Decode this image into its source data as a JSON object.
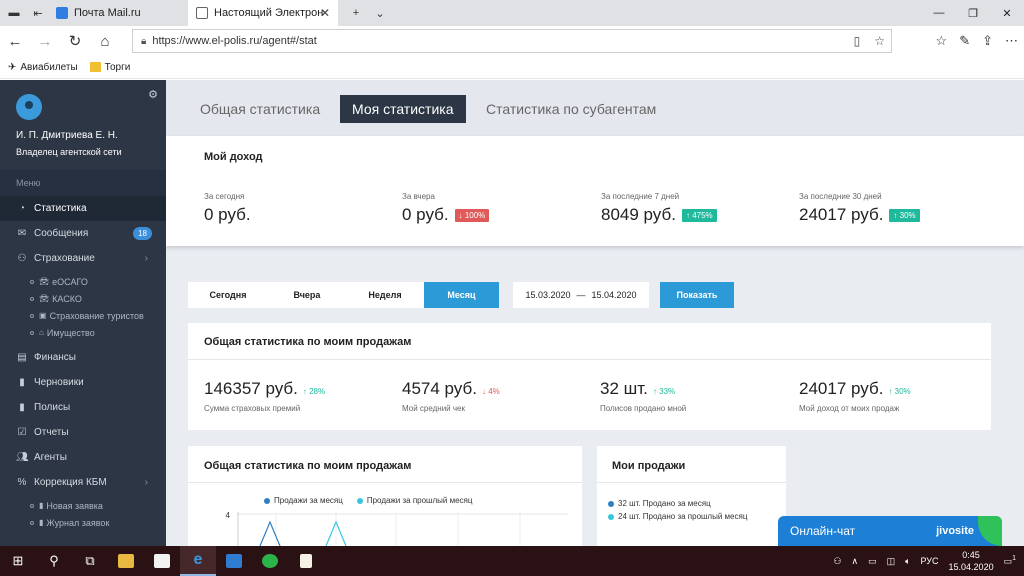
{
  "browser": {
    "tabs": [
      {
        "label": "Почта Mail.ru",
        "active": false
      },
      {
        "label": "Настоящий Электронн",
        "active": true
      }
    ],
    "url": "https://www.el-polis.ru/agent#/stat",
    "bookmarks": [
      "Авиабилеты",
      "Торги"
    ]
  },
  "sidebar": {
    "name": "И. П. Дмитриева Е. Н.",
    "role": "Владелец агентской сети",
    "menu_title": "Меню",
    "items": [
      {
        "label": "Статистика",
        "icon": "pie-chart-icon"
      },
      {
        "label": "Сообщения",
        "icon": "envelope-icon",
        "badge": "18"
      },
      {
        "label": "Страхование",
        "icon": "sitemap-icon"
      },
      {
        "label": "Финансы",
        "icon": "money-icon"
      },
      {
        "label": "Черновики",
        "icon": "file-icon"
      },
      {
        "label": "Полисы",
        "icon": "file-text-icon"
      },
      {
        "label": "Отчеты",
        "icon": "check-square-icon"
      },
      {
        "label": "Агенты",
        "icon": "users-icon"
      },
      {
        "label": "Коррекция КБМ",
        "icon": "percent-icon"
      }
    ],
    "insurance_sub": [
      "еОСАГО",
      "КАСКО",
      "Страхование туристов",
      "Имущество"
    ],
    "kbm_sub": [
      "Новая заявка",
      "Журнал заявок"
    ]
  },
  "main": {
    "tabs": [
      "Общая статистика",
      "Моя статистика",
      "Статистика по субагентам"
    ],
    "income": {
      "title": "Мой доход",
      "kpis": [
        {
          "label": "За сегодня",
          "value": "0 руб.",
          "change": ""
        },
        {
          "label": "За вчера",
          "value": "0 руб.",
          "change": "↓ 100%",
          "dir": "down"
        },
        {
          "label": "За последние 7 дней",
          "value": "8049 руб.",
          "change": "↑ 475%",
          "dir": "up"
        },
        {
          "label": "За последние 30 дней",
          "value": "24017 руб.",
          "change": "↑ 30%",
          "dir": "up"
        }
      ]
    },
    "filter": {
      "periods": [
        "Сегодня",
        "Вчера",
        "Неделя",
        "Месяц"
      ],
      "active_period": "Месяц",
      "date_from": "15.03.2020",
      "date_sep": "—",
      "date_to": "15.04.2020",
      "show_label": "Показать"
    },
    "sales": {
      "title": "Общая статистика по моим продажам",
      "kpis": [
        {
          "value": "146357 руб.",
          "change": "↑ 28%",
          "dir": "up",
          "label": "Сумма страховых премий"
        },
        {
          "value": "4574 руб.",
          "change": "↓ 4%",
          "dir": "down",
          "label": "Мой средний чек"
        },
        {
          "value": "32 шт.",
          "change": "↑ 33%",
          "dir": "up",
          "label": "Полисов продано мной"
        },
        {
          "value": "24017 руб.",
          "change": "↑ 30%",
          "dir": "up",
          "label": "Мой доход от моих продаж"
        }
      ]
    },
    "chart_card": {
      "title": "Общая статистика по моим продажам",
      "legend": [
        "Продажи за месяц",
        "Продажи за прошлый месяц"
      ],
      "y_tick": "4"
    },
    "my_sales": {
      "title": "Мои продажи",
      "legend": [
        "32 шт. Продано за месяц",
        "24 шт. Продано за прошлый месяц"
      ]
    }
  },
  "chat": {
    "label": "Онлайн-чат",
    "brand": "jivosite"
  },
  "taskbar": {
    "lang": "РУС",
    "time": "0:45",
    "date": "15.04.2020",
    "notif_count": "1"
  },
  "colors": {
    "sidebar_bg": "#2c3645",
    "accent": "#2d9ad8",
    "up": "#1fb99b",
    "down": "#e05a5a",
    "series_current": "#2d7fc4",
    "series_previous": "#36c6e0"
  }
}
